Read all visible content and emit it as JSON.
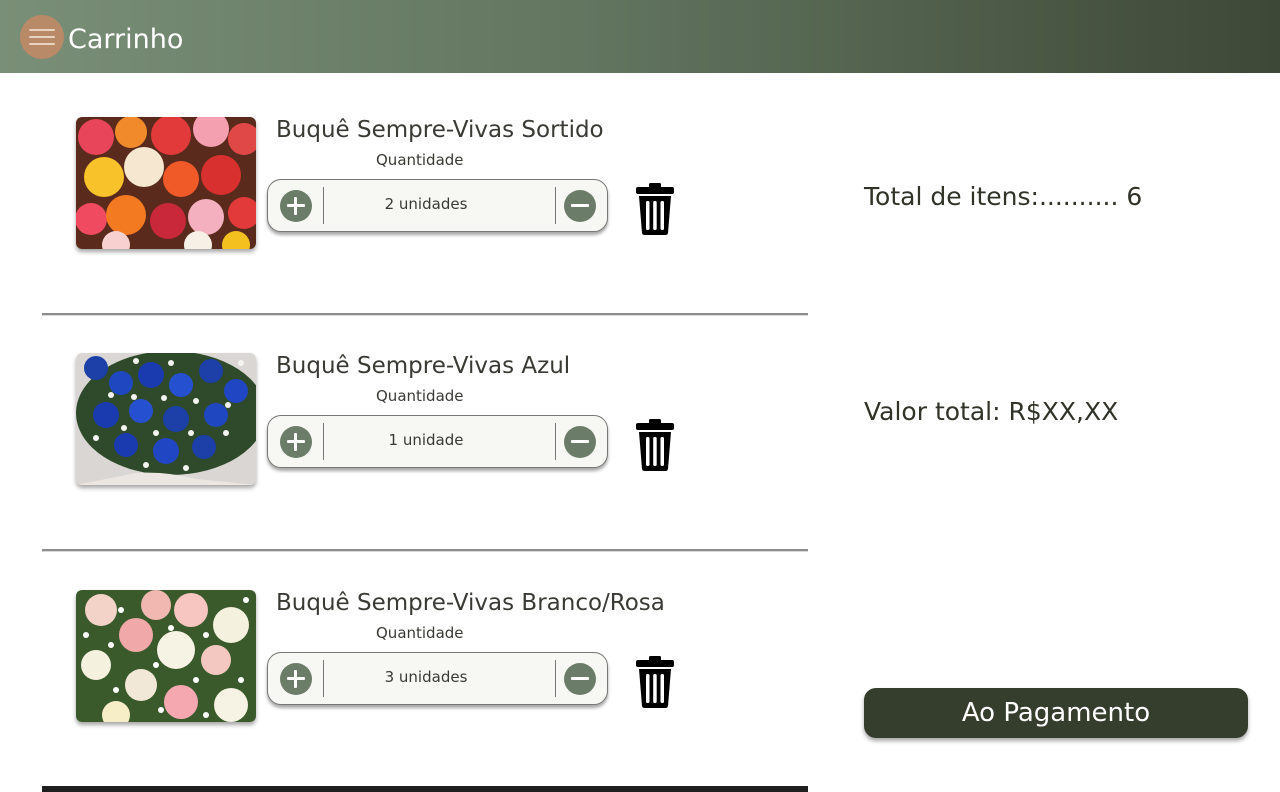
{
  "header": {
    "title": "Carrinho",
    "menu_icon": "hamburger-menu-icon"
  },
  "items": [
    {
      "name": "Buquê Sempre-Vivas Sortido",
      "quantity_label": "Quantidade",
      "quantity_text": "2 unidades"
    },
    {
      "name": "Buquê Sempre-Vivas Azul",
      "quantity_label": "Quantidade",
      "quantity_text": "1 unidade"
    },
    {
      "name": "Buquê Sempre-Vivas Branco/Rosa",
      "quantity_label": "Quantidade",
      "quantity_text": "3 unidades"
    }
  ],
  "summary": {
    "total_items": "Total de itens:.......... 6",
    "total_value": "Valor total: R$XX,XX"
  },
  "pay_button": {
    "label": "Ao Pagamento"
  },
  "colors": {
    "header_start": "#7a8f77",
    "header_end": "#3e4836",
    "accent": "#6b7d68",
    "button": "#353d2d"
  }
}
